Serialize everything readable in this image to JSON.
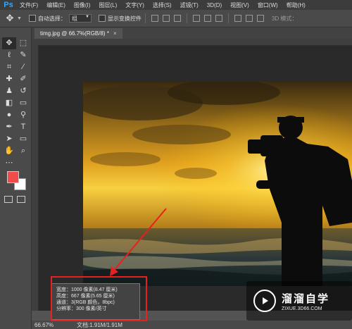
{
  "app": {
    "logo": "Ps",
    "title": "Photoshop"
  },
  "menu": {
    "items": [
      "文件(F)",
      "编辑(E)",
      "图像(I)",
      "图层(L)",
      "文字(Y)",
      "选择(S)",
      "滤镜(T)",
      "3D(D)",
      "视图(V)",
      "窗口(W)",
      "帮助(H)"
    ]
  },
  "options": {
    "auto_select_label": "自动选择：",
    "auto_select_value": "组",
    "show_transform_label": "显示变换控件",
    "mode_label": "3D 模式："
  },
  "document": {
    "tab_title": "timg.jpg @ 66.7%(RGB/8) *",
    "close_glyph": "×"
  },
  "info": {
    "width": "宽度：1000 像素(8.47 厘米)",
    "height": "高度：667 像素(5.65 厘米)",
    "channels": "通道：3(RGB 颜色，8bpc)",
    "resolution": "分辨率：300 像素/英寸"
  },
  "status": {
    "zoom": "66.67%",
    "docsize": "文档:1.91M/1.91M"
  },
  "watermark": {
    "title": "溜溜自学",
    "url": "ZIXUE.3D66.COM"
  },
  "colors": {
    "foreground": "#f04c4c",
    "background": "#ffffff",
    "highlight": "#e82020",
    "ps_blue": "#31a8ff"
  },
  "icons": [
    "move-icon",
    "marquee-icon",
    "lasso-icon",
    "quick-select-icon",
    "crop-icon",
    "eyedropper-icon",
    "healing-icon",
    "brush-icon",
    "stamp-icon",
    "history-brush-icon",
    "eraser-icon",
    "gradient-icon",
    "blur-icon",
    "dodge-icon",
    "pen-icon",
    "type-icon",
    "path-select-icon",
    "shape-icon",
    "hand-icon",
    "zoom-icon"
  ]
}
